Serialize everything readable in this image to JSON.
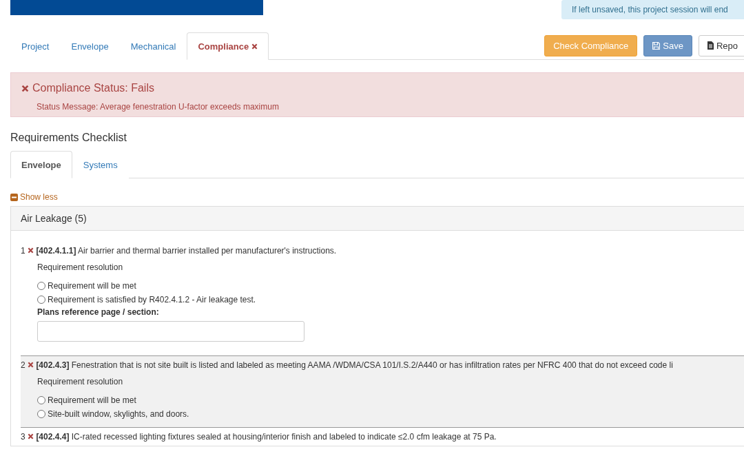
{
  "session_notice": "If left unsaved, this project session will end",
  "nav_tabs": [
    {
      "label": "Project",
      "selected": false,
      "failed": false
    },
    {
      "label": "Envelope",
      "selected": false,
      "failed": false
    },
    {
      "label": "Mechanical",
      "selected": false,
      "failed": false
    },
    {
      "label": "Compliance",
      "selected": true,
      "failed": true
    }
  ],
  "actions": [
    {
      "kind": "warning",
      "label": "Check Compliance"
    },
    {
      "kind": "primary",
      "label": "Save"
    },
    {
      "kind": "default",
      "label": "Repo"
    }
  ],
  "alert": {
    "title": "Compliance Status: Fails",
    "message": "Status Message: Average fenestration U-factor exceeds maximum"
  },
  "checklist": {
    "title": "Requirements Checklist",
    "tabs": [
      {
        "label": "Envelope",
        "selected": true
      },
      {
        "label": "Systems",
        "selected": false
      }
    ],
    "toggle": "Show less",
    "section": {
      "title": "Air Leakage (5)",
      "items": [
        {
          "number": "1",
          "code": "[402.4.1.1]",
          "text": "Air barrier and thermal barrier installed per manufacturer's instructions.",
          "shaded": false,
          "resolution_label": "Requirement resolution",
          "options": [
            {
              "label": "Requirement will be met",
              "selected": false
            },
            {
              "label": "Requirement is satisfied by R402.4.1.2 - Air leakage test.",
              "selected": false
            }
          ],
          "field_label": "Plans reference page / section:"
        },
        {
          "number": "2",
          "code": "[402.4.3]",
          "text": "Fenestration that is not site built is listed and labeled as meeting AAMA /WDMA/CSA 101/I.S.2/A440 or has infiltration rates per NFRC 400 that do not exceed code li",
          "shaded": true,
          "resolution_label": "Requirement resolution",
          "options": [
            {
              "label": "Requirement will be met",
              "selected": false
            },
            {
              "label": "Site-built window, skylights, and doors.",
              "selected": false
            }
          ]
        },
        {
          "number": "3",
          "code": "[402.4.4]",
          "text": "IC-rated recessed lighting fixtures sealed at housing/interior finish and labeled to indicate ≤2.0 cfm leakage at 75 Pa.",
          "shaded": false
        }
      ]
    }
  }
}
